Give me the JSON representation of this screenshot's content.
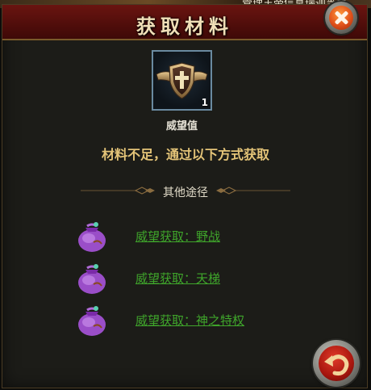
{
  "background": {
    "partial_text": "管理王帝信息瑞迦当关"
  },
  "dialog": {
    "title": "获取材料",
    "item": {
      "name": "威望值",
      "count": "1",
      "icon": "shield-wings-emblem-icon"
    },
    "notice": "材料不足，通过以下方式获取",
    "section_label": "其他途径",
    "routes": [
      {
        "label": "威望获取：野战",
        "icon": "purple-bag-icon"
      },
      {
        "label": "威望获取：天梯",
        "icon": "purple-bag-icon"
      },
      {
        "label": "威望获取：神之特权",
        "icon": "purple-bag-icon"
      }
    ]
  },
  "colors": {
    "header": "#5a100c",
    "title_text": "#f0dfb7",
    "notice_text": "#e4c478",
    "link_text": "#3fa52b",
    "panel": "#1c1c18"
  }
}
